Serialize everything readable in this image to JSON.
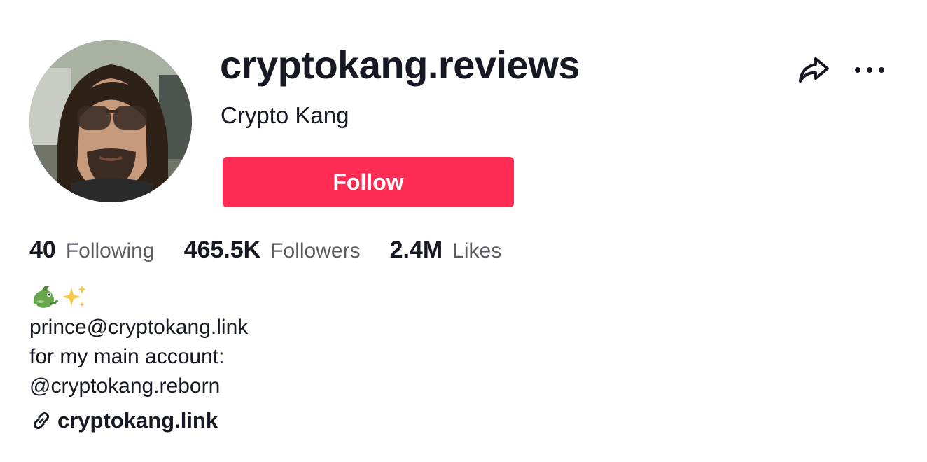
{
  "profile": {
    "username": "cryptokang.reviews",
    "display_name": "Crypto Kang",
    "follow_label": "Follow",
    "avatar_icon": "avatar-icon"
  },
  "actions": {
    "share_icon": "share-icon",
    "more_icon": "more-icon"
  },
  "stats": [
    {
      "value": "40",
      "label": "Following"
    },
    {
      "value": "465.5K",
      "label": "Followers"
    },
    {
      "value": "2.4M",
      "label": "Likes"
    }
  ],
  "bio": {
    "emoji": [
      "dragon-emoji",
      "sparkles-emoji"
    ],
    "lines": [
      "prince@cryptokang.link",
      "for my main account:",
      "@cryptokang.reborn"
    ]
  },
  "link": {
    "icon": "link-icon",
    "text": "cryptokang.link"
  },
  "colors": {
    "accent": "#fe2c55",
    "text": "#161823",
    "secondary_text": "#5a5b63"
  }
}
